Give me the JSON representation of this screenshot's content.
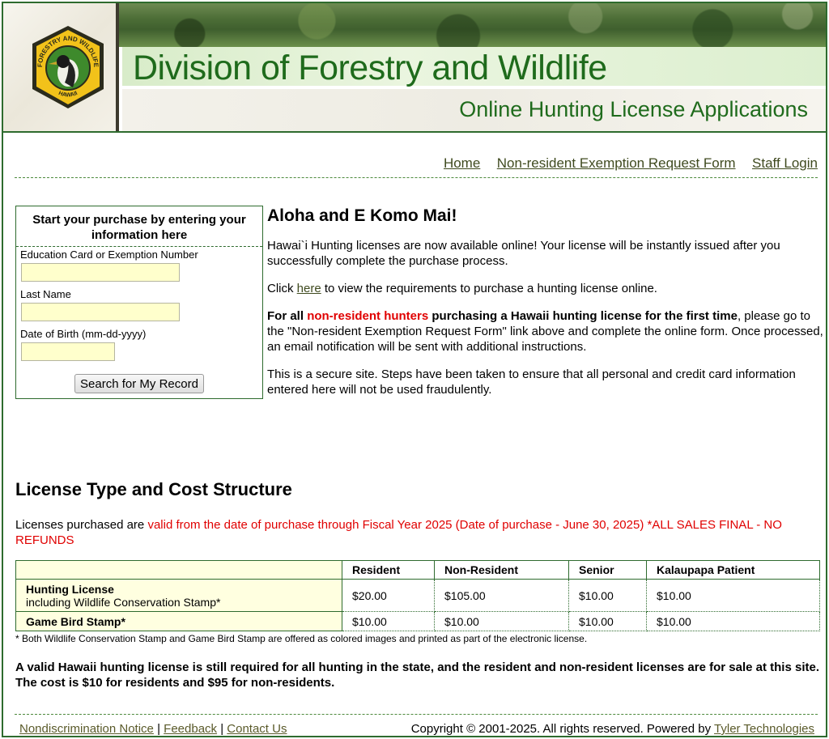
{
  "banner": {
    "title": "Division of Forestry and Wildlife",
    "subtitle": "Online Hunting License Applications",
    "seal_top_text": "FORESTRY AND WILDLIFE",
    "seal_bottom_text": "HAWAII"
  },
  "nav": {
    "items": [
      {
        "label": "Home"
      },
      {
        "label": "Non-resident Exemption Request Form"
      },
      {
        "label": "Staff Login"
      }
    ]
  },
  "search": {
    "heading": "Start your purchase by entering your information here",
    "fields": [
      {
        "label": "Education Card or Exemption Number",
        "value": ""
      },
      {
        "label": "Last Name",
        "value": ""
      },
      {
        "label": "Date of Birth (mm-dd-yyyy)",
        "value": ""
      }
    ],
    "button_label": "Search for My Record"
  },
  "welcome": {
    "heading": "Aloha and E Komo Mai!",
    "p1": "Hawai`i Hunting licenses are now available online! Your license will be instantly issued after you successfully complete the purchase process.",
    "p2_before": "Click",
    "p2_link": "here",
    "p2_after": "to view the requirements to purchase a hunting license online.",
    "p3_bold1": "For all",
    "p3_red": "non-resident hunters",
    "p3_bold2": "purchasing a Hawaii hunting license for the first time",
    "p3_rest": ", please go to the \"Non-resident Exemption Request Form\" link above and complete the online form. Once processed, an email notification will be sent with additional instructions.",
    "p4": "This is a secure site. Steps have been taken to ensure that all personal and credit card information entered here will not be used fraudulently."
  },
  "license": {
    "heading": "License Type and Cost Structure",
    "note_prefix": "Licenses purchased are",
    "note_red": "valid from the date of purchase through Fiscal Year 2025 (Date of purchase - June 30, 2025) *ALL SALES FINAL - NO REFUNDS",
    "columns": [
      "Resident",
      "Non-Resident",
      "Senior",
      "Kalaupapa Patient"
    ],
    "rows": [
      {
        "name": "Hunting License",
        "sub": "including Wildlife Conservation Stamp*",
        "values": [
          "$20.00",
          "$105.00",
          "$10.00",
          "$10.00"
        ]
      },
      {
        "name": "Game Bird Stamp*",
        "sub": "",
        "values": [
          "$10.00",
          "$10.00",
          "$10.00",
          "$10.00"
        ]
      }
    ],
    "footnote": "* Both Wildlife Conservation Stamp and Game Bird Stamp are offered as colored images and printed as part of the electronic license.",
    "bold_note": "A valid Hawaii hunting license is still required for all hunting in the state, and the resident and non-resident licenses are for sale at this site. The cost is $10 for residents and $95 for non-residents."
  },
  "footer": {
    "links": [
      {
        "label": "Nondiscrimination Notice"
      },
      {
        "label": "Feedback"
      },
      {
        "label": "Contact Us"
      }
    ],
    "separator": "|",
    "copyright": "Copyright © 2001-2025. All rights reserved. Powered by",
    "powered_by": "Tyler Technologies"
  },
  "colors": {
    "brand_green": "#1f6b1c",
    "border_green": "#2e6b2e",
    "alert_red": "#e00000",
    "input_yellow": "#ffffcc",
    "link_olive": "#3f4a1f"
  }
}
